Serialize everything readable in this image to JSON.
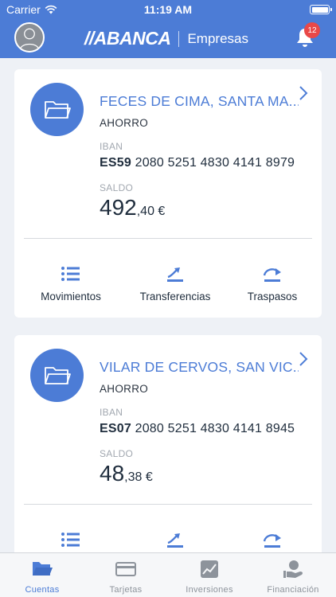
{
  "status_bar": {
    "carrier": "Carrier",
    "time": "11:19 AM"
  },
  "header": {
    "brand": "//ABANCA",
    "subtitle": "Empresas",
    "notifications": "12"
  },
  "accounts": [
    {
      "name": "FECES DE CIMA, SANTA MA...",
      "type": "AHORRO",
      "iban_label": "IBAN",
      "iban_prefix": "ES59",
      "iban_number": "2080 5251 4830 4141 8979",
      "saldo_label": "SALDO",
      "balance_int": "492",
      "balance_dec": ",40 €"
    },
    {
      "name": "VILAR DE CERVOS, SAN VIC...",
      "type": "AHORRO",
      "iban_label": "IBAN",
      "iban_prefix": "ES07",
      "iban_number": "2080 5251 4830 4141 8945",
      "saldo_label": "SALDO",
      "balance_int": "48",
      "balance_dec": ",38 €"
    }
  ],
  "actions": {
    "movimientos": "Movimientos",
    "transferencias": "Transferencias",
    "traspasos": "Traspasos"
  },
  "tabs": [
    {
      "label": "Cuentas",
      "icon": "folder-icon",
      "active": true
    },
    {
      "label": "Tarjetas",
      "icon": "card-icon",
      "active": false
    },
    {
      "label": "Inversiones",
      "icon": "chart-icon",
      "active": false
    },
    {
      "label": "Financiación",
      "icon": "financing-icon",
      "active": false
    }
  ],
  "colors": {
    "primary": "#4c7cd6",
    "badge": "#e94848",
    "background": "#eef1f6"
  }
}
